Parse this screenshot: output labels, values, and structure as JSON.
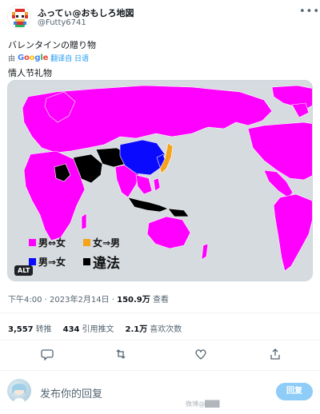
{
  "author": {
    "name": "ふってぃ@おもしろ地図",
    "handle": "@Futty6741"
  },
  "tweet": {
    "text": "バレンタインの贈り物",
    "translate_by": "由",
    "translate_brand": "Google",
    "translate_link": "翻译自 日语",
    "translated_text": "情人节礼物"
  },
  "map": {
    "alt_label": "ALT",
    "legend": [
      {
        "label": "男⇔女",
        "color": "#ff00ff"
      },
      {
        "label": "女⇒男",
        "color": "#f5a31a"
      },
      {
        "label": "男⇒女",
        "color": "#0a0aff"
      },
      {
        "label": "違法",
        "color": "#000000"
      }
    ],
    "colors": {
      "ocean": "#d6dbdf",
      "border": "#ffffff"
    }
  },
  "meta": {
    "time": "下午4:00",
    "date": "2023年2月14日",
    "views_count": "150.9万",
    "views_label": "查看"
  },
  "stats": [
    {
      "count": "3,557",
      "label": "转推"
    },
    {
      "count": "434",
      "label": "引用推文"
    },
    {
      "count": "2.1万",
      "label": "喜欢次数"
    }
  ],
  "actions": {
    "reply_icon": "reply-icon",
    "retweet_icon": "retweet-icon",
    "like_icon": "heart-icon",
    "share_icon": "share-icon"
  },
  "reply": {
    "placeholder": "发布你的回复",
    "button_label": "回复"
  },
  "watermark": "微博@███"
}
